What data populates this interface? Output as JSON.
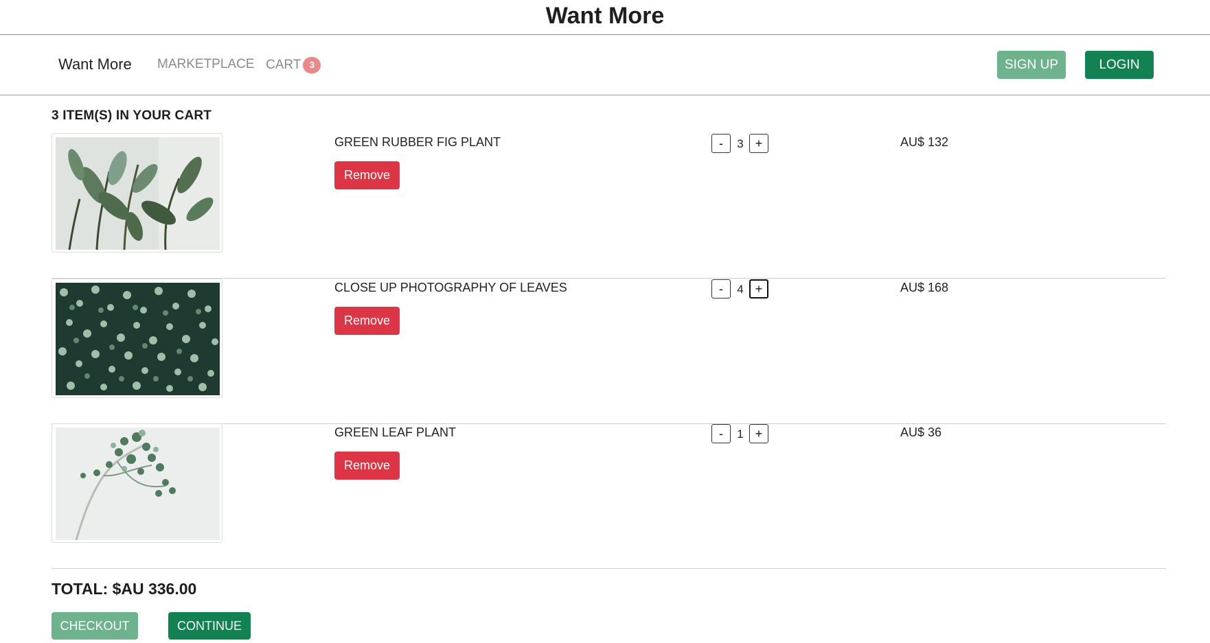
{
  "site": {
    "title": "Want More"
  },
  "nav": {
    "brand": "Want More",
    "marketplace": "MARKETPLACE",
    "cart": "CART",
    "cart_count": "3",
    "signup": "SIGN UP",
    "login": "LOGIN"
  },
  "cart": {
    "heading": "3 ITEM(S) IN YOUR CART",
    "items": [
      {
        "name": "GREEN RUBBER FIG PLANT",
        "quantity": "3",
        "price": "AU$ 132",
        "remove_label": "Remove",
        "minus": "-",
        "plus": "+",
        "image": "rubber-fig-plant-photo"
      },
      {
        "name": "CLOSE UP PHOTOGRAPHY OF LEAVES",
        "quantity": "4",
        "price": "AU$ 168",
        "remove_label": "Remove",
        "minus": "-",
        "plus": "+",
        "image": "leaves-closeup-photo"
      },
      {
        "name": "GREEN LEAF PLANT",
        "quantity": "1",
        "price": "AU$ 36",
        "remove_label": "Remove",
        "minus": "-",
        "plus": "+",
        "image": "green-leaf-plant-photo"
      }
    ],
    "total": "TOTAL: $AU 336.00",
    "checkout": "CHECKOUT",
    "continue": "CONTINUE"
  },
  "colors": {
    "primary_green": "#138151",
    "light_green": "#6fb38e",
    "danger_red": "#dc3545",
    "badge": "#e98a8a"
  }
}
